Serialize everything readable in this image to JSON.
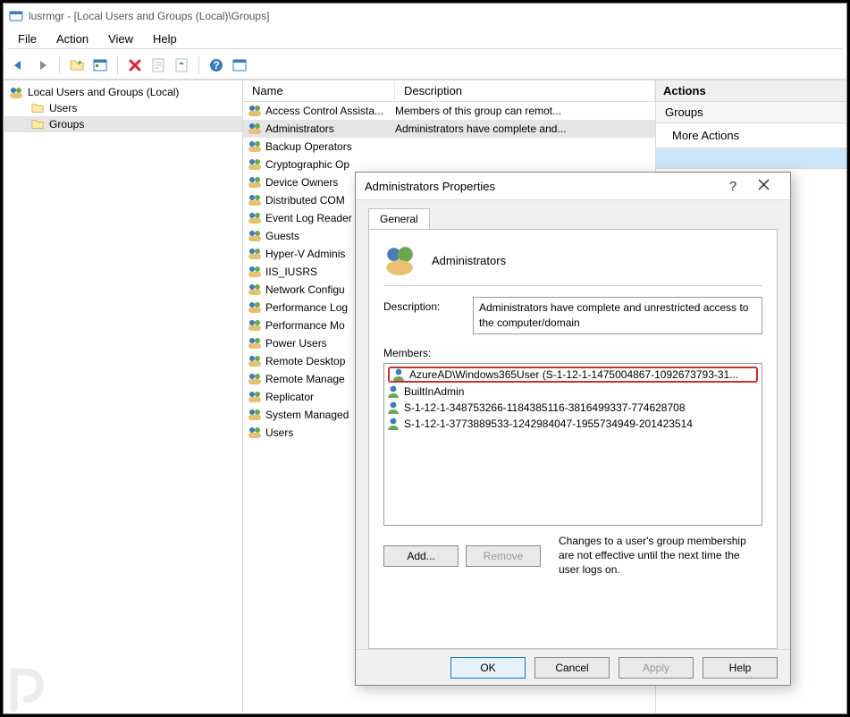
{
  "title_bar": "lusrmgr - [Local Users and Groups (Local)\\Groups]",
  "menu": {
    "file": "File",
    "action": "Action",
    "view": "View",
    "help": "Help"
  },
  "tree": {
    "root": "Local Users and Groups (Local)",
    "users": "Users",
    "groups": "Groups"
  },
  "list_headers": {
    "name": "Name",
    "description": "Description"
  },
  "groups": [
    {
      "name": "Access Control Assista...",
      "desc": "Members of this group can remot..."
    },
    {
      "name": "Administrators",
      "desc": "Administrators have complete and..."
    },
    {
      "name": "Backup Operators",
      "desc": ""
    },
    {
      "name": "Cryptographic Op",
      "desc": ""
    },
    {
      "name": "Device Owners",
      "desc": ""
    },
    {
      "name": "Distributed COM",
      "desc": ""
    },
    {
      "name": "Event Log Reader",
      "desc": ""
    },
    {
      "name": "Guests",
      "desc": ""
    },
    {
      "name": "Hyper-V Adminis",
      "desc": ""
    },
    {
      "name": "IIS_IUSRS",
      "desc": ""
    },
    {
      "name": "Network Configu",
      "desc": ""
    },
    {
      "name": "Performance Log",
      "desc": ""
    },
    {
      "name": "Performance Mo",
      "desc": ""
    },
    {
      "name": "Power Users",
      "desc": ""
    },
    {
      "name": "Remote Desktop",
      "desc": ""
    },
    {
      "name": "Remote Manage",
      "desc": ""
    },
    {
      "name": "Replicator",
      "desc": ""
    },
    {
      "name": "System Managed",
      "desc": ""
    },
    {
      "name": "Users",
      "desc": ""
    }
  ],
  "actions": {
    "header": "Actions",
    "groups_label": "Groups",
    "more_actions": "More Actions"
  },
  "dialog": {
    "title": "Administrators Properties",
    "tab_general": "General",
    "group_name": "Administrators",
    "description_label": "Description:",
    "description_value": "Administrators have complete and unrestricted access to the computer/domain",
    "members_label": "Members:",
    "members": [
      "AzureAD\\Windows365User (S-1-12-1-1475004867-1092673793-31...",
      "BuiltInAdmin",
      "S-1-12-1-348753266-1184385116-3816499337-774628708",
      "S-1-12-1-3773889533-1242984047-1955734949-201423514"
    ],
    "add": "Add...",
    "remove": "Remove",
    "note": "Changes to a user's group membership are not effective until the next time the user logs on.",
    "ok": "OK",
    "cancel": "Cancel",
    "apply": "Apply",
    "help": "Help"
  }
}
